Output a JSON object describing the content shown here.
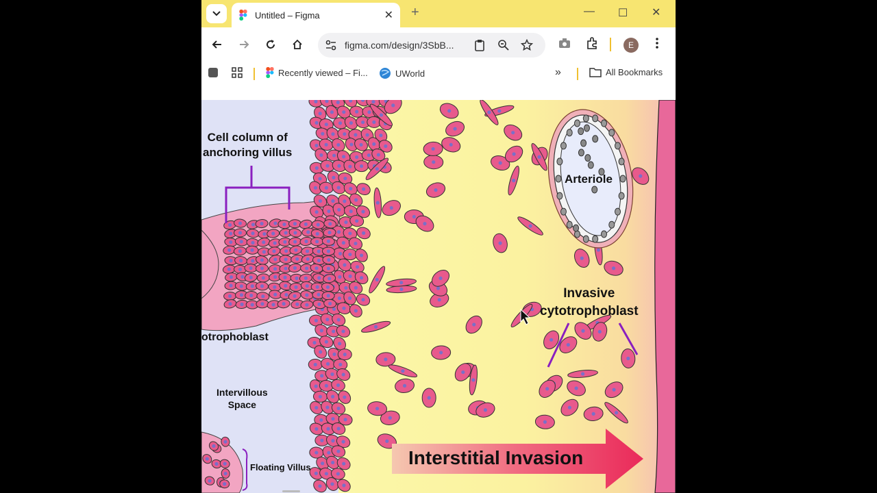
{
  "browser": {
    "tab_title": "Untitled – Figma",
    "url": "figma.com/design/3SbB...",
    "profile_initial": "E",
    "bookmarks": {
      "recently_viewed": "Recently viewed – Fi...",
      "uworld": "UWorld",
      "all_bookmarks": "All Bookmarks"
    },
    "colors": {
      "tabstrip": "#f7e571",
      "accent_sep": "#f0c030"
    }
  },
  "diagram": {
    "labels": {
      "cell_column": "Cell column of\nanchoring villus",
      "arteriole": "Arteriole",
      "invasive": "Invasive\ncytotrophoblast",
      "syncytio": "otrophoblast",
      "intervillous": "Intervillous\nSpace",
      "floating_villus": "Floating Villus",
      "interstitial": "Interstitial Invasion"
    },
    "colors": {
      "cell_fill": "#e85a8c",
      "nucleus": "#7a6fc8",
      "decidua": "#fbf5a0",
      "intervillous_space": "#dfe2f6",
      "bracket": "#8a1fbf",
      "arrow": "#ea2a5a"
    }
  }
}
